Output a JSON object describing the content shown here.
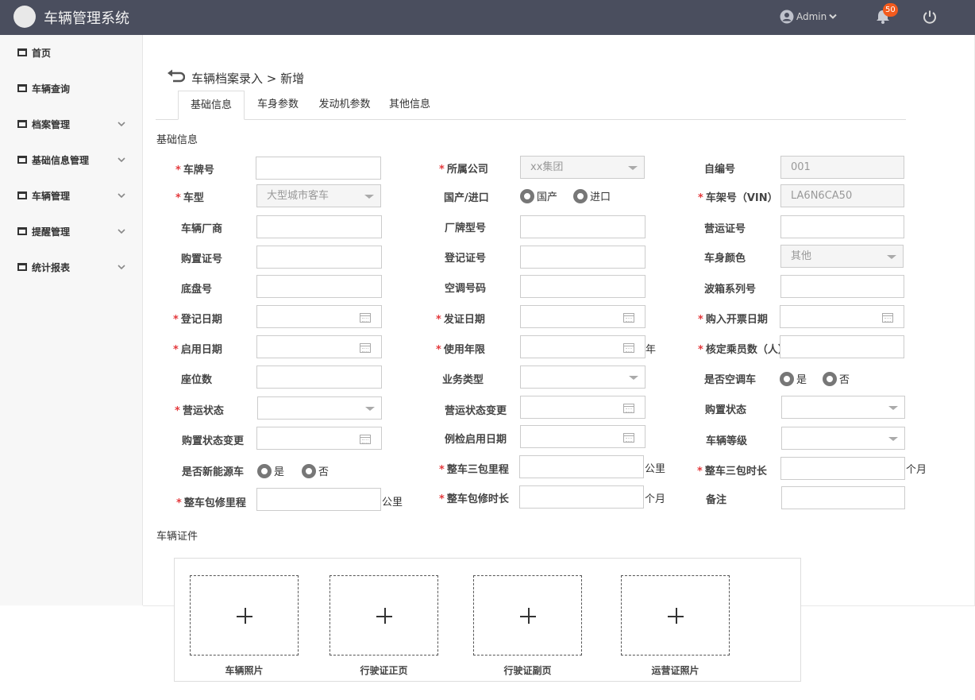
{
  "header": {
    "title": "车辆管理系统",
    "user": "Admin",
    "notifications": "50"
  },
  "sidebar": {
    "items": [
      {
        "label": "首页",
        "has_children": false
      },
      {
        "label": "车辆查询",
        "has_children": false
      },
      {
        "label": "档案管理",
        "has_children": true
      },
      {
        "label": "基础信息管理",
        "has_children": true
      },
      {
        "label": "车辆管理",
        "has_children": true
      },
      {
        "label": "提醒管理",
        "has_children": true
      },
      {
        "label": "统计报表",
        "has_children": true
      }
    ]
  },
  "breadcrumb": "车辆档案录入 > 新增",
  "tabs": [
    "基础信息",
    "车身参数",
    "发动机参数",
    "其他信息"
  ],
  "sections": {
    "basic": "基础信息",
    "certificates": "车辆证件"
  },
  "fields": {
    "plate": {
      "label": "车牌号",
      "required": true,
      "value": ""
    },
    "company": {
      "label": "所属公司",
      "required": true,
      "value": "xx集团"
    },
    "self_no": {
      "label": "自编号",
      "required": false,
      "value": "001"
    },
    "model": {
      "label": "车型",
      "required": true,
      "value": "大型城市客车"
    },
    "origin": {
      "label": "国产/进口",
      "options": [
        "国产",
        "进口"
      ]
    },
    "vin": {
      "label": "车架号（VIN）",
      "required": true,
      "value": "LA6N6CA50"
    },
    "maker": {
      "label": "车辆厂商"
    },
    "brand_model": {
      "label": "厂牌型号"
    },
    "operating_cert": {
      "label": "营运证号"
    },
    "purchase_cert": {
      "label": "购置证号"
    },
    "register_cert": {
      "label": "登记证号"
    },
    "body_color": {
      "label": "车身颜色",
      "value": "其他"
    },
    "chassis_no": {
      "label": "底盘号"
    },
    "ac_no": {
      "label": "空调号码"
    },
    "gearbox_serial": {
      "label": "波箱系列号"
    },
    "register_date": {
      "label": "登记日期",
      "required": true
    },
    "issue_date": {
      "label": "发证日期",
      "required": true
    },
    "invoice_date": {
      "label": "购入开票日期",
      "required": true
    },
    "start_date": {
      "label": "启用日期",
      "required": true
    },
    "service_years": {
      "label": "使用年限",
      "required": true,
      "unit": "年"
    },
    "seats_rated": {
      "label": "核定乘员数（人）",
      "required": true
    },
    "seat_count": {
      "label": "座位数"
    },
    "business_type": {
      "label": "业务类型"
    },
    "has_ac": {
      "label": "是否空调车",
      "options": [
        "是",
        "否"
      ]
    },
    "op_status": {
      "label": "营运状态",
      "required": true
    },
    "op_status_change": {
      "label": "营运状态变更"
    },
    "purchase_status": {
      "label": "购置状态"
    },
    "purchase_status_change": {
      "label": "购置状态变更"
    },
    "inspection_start": {
      "label": "例检启用日期"
    },
    "vehicle_level": {
      "label": "车辆等级"
    },
    "new_energy": {
      "label": "是否新能源车",
      "options": [
        "是",
        "否"
      ]
    },
    "warranty3_mileage": {
      "label": "整车三包里程",
      "required": true,
      "unit": "公里"
    },
    "warranty3_duration": {
      "label": "整车三包时长",
      "required": true,
      "unit": "个月"
    },
    "repair_mileage": {
      "label": "整车包修里程",
      "required": true,
      "unit": "公里"
    },
    "repair_duration": {
      "label": "整车包修时长",
      "required": true,
      "unit": "个月"
    },
    "remark": {
      "label": "备注"
    }
  },
  "uploads": [
    "车辆照片",
    "行驶证正页",
    "行驶证副页",
    "运营证照片"
  ],
  "colors": {
    "topbar": "#4a4e5e",
    "badge": "#f25a1d",
    "required": "#e4393c"
  }
}
